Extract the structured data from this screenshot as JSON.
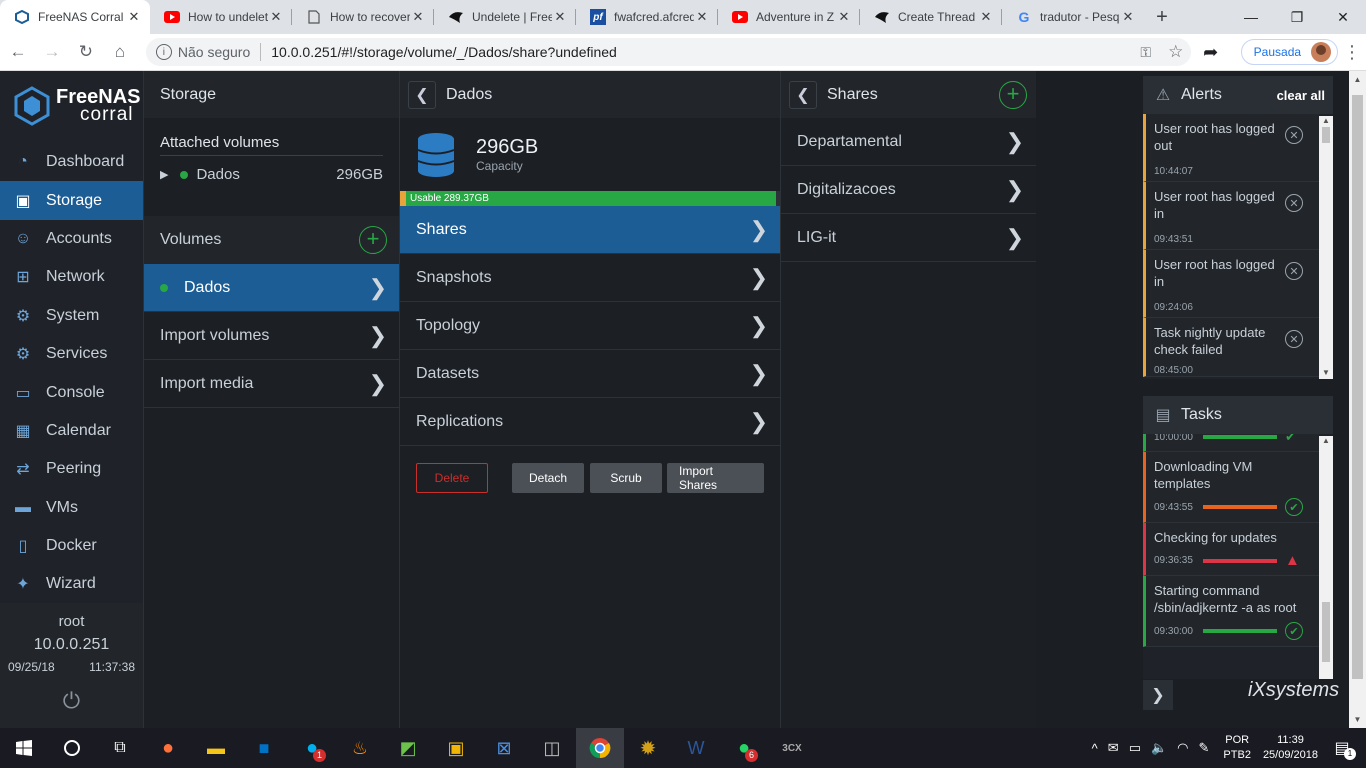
{
  "browser": {
    "tabs": [
      {
        "label": "FreeNAS Corral",
        "icon": "freenas-favicon",
        "active": true
      },
      {
        "label": "How to undelete",
        "icon": "youtube-icon"
      },
      {
        "label": "How to recover",
        "icon": "page-icon"
      },
      {
        "label": "Undelete | Free",
        "icon": "bird-icon"
      },
      {
        "label": "fwafcred.afcred",
        "icon": "pf-icon"
      },
      {
        "label": "Adventure in Z",
        "icon": "youtube-icon"
      },
      {
        "label": "Create Thread",
        "icon": "bird-icon"
      },
      {
        "label": "tradutor - Pesq",
        "icon": "google-icon"
      }
    ],
    "security_label": "Não seguro",
    "url": "10.0.0.251/#!/storage/volume/_/Dados/share?undefined",
    "profile_label": "Pausada"
  },
  "sidebar": {
    "brand_line1": "FreeNAS",
    "brand_line2": "corral",
    "items": [
      {
        "label": "Dashboard",
        "icon": "dashboard-icon"
      },
      {
        "label": "Storage",
        "icon": "storage-icon",
        "active": true
      },
      {
        "label": "Accounts",
        "icon": "accounts-icon"
      },
      {
        "label": "Network",
        "icon": "network-icon"
      },
      {
        "label": "System",
        "icon": "system-icon"
      },
      {
        "label": "Services",
        "icon": "services-icon"
      },
      {
        "label": "Console",
        "icon": "console-icon"
      },
      {
        "label": "Calendar",
        "icon": "calendar-icon"
      },
      {
        "label": "Peering",
        "icon": "peering-icon"
      },
      {
        "label": "VMs",
        "icon": "vms-icon"
      },
      {
        "label": "Docker",
        "icon": "docker-icon"
      },
      {
        "label": "Wizard",
        "icon": "wizard-icon"
      }
    ],
    "user": "root",
    "ip": "10.0.0.251",
    "date": "09/25/18",
    "time": "11:37:38"
  },
  "storage": {
    "title": "Storage",
    "attached_title": "Attached volumes",
    "attached": [
      {
        "name": "Dados",
        "size": "296GB"
      }
    ],
    "volumes_title": "Volumes",
    "volumes": [
      {
        "name": "Dados"
      }
    ],
    "import_volumes": "Import volumes",
    "import_media": "Import media"
  },
  "volume": {
    "title": "Dados",
    "capacity": "296GB",
    "capacity_label": "Capacity",
    "usable": "Usable 289.37GB",
    "usage_percent": 99,
    "menu": [
      "Shares",
      "Snapshots",
      "Topology",
      "Datasets",
      "Replications"
    ],
    "buttons": {
      "delete": "Delete",
      "detach": "Detach",
      "scrub": "Scrub",
      "import_shares": "Import Shares"
    }
  },
  "shares": {
    "title": "Shares",
    "items": [
      "Departamental",
      "Digitalizacoes",
      "LIG-it"
    ]
  },
  "alerts": {
    "title": "Alerts",
    "clear_all": "clear all",
    "items": [
      {
        "text": "User root has logged out",
        "time": "10:44:07"
      },
      {
        "text": "User root has logged in",
        "time": "09:43:51"
      },
      {
        "text": "User root has logged in",
        "time": "09:24:06"
      },
      {
        "text": "Task nightly update check failed",
        "time": "08:45:00"
      }
    ]
  },
  "tasks": {
    "title": "Tasks",
    "partial_time": "10:00:00",
    "items": [
      {
        "text": "Downloading VM templates",
        "time": "09:43:55",
        "status": "success",
        "color": "#e8641e"
      },
      {
        "text": "Checking for updates",
        "time": "09:36:35",
        "status": "failed",
        "color": "#dc3545"
      },
      {
        "text": "Starting command /sbin/adjkerntz -a as root",
        "time": "09:30:00",
        "status": "success",
        "color": "#28a745"
      }
    ]
  },
  "vendor_logo": "iXsystems",
  "taskbar": {
    "lang_line1": "POR",
    "lang_line2": "PTB2",
    "time": "11:39",
    "date": "25/09/2018",
    "skype_badge": "1",
    "whatsapp_badge": "6",
    "notif_badge": "1"
  },
  "colors": {
    "accent": "#1c5d96",
    "success": "#28a745",
    "warning": "#e8a33a",
    "danger": "#dc3545"
  }
}
